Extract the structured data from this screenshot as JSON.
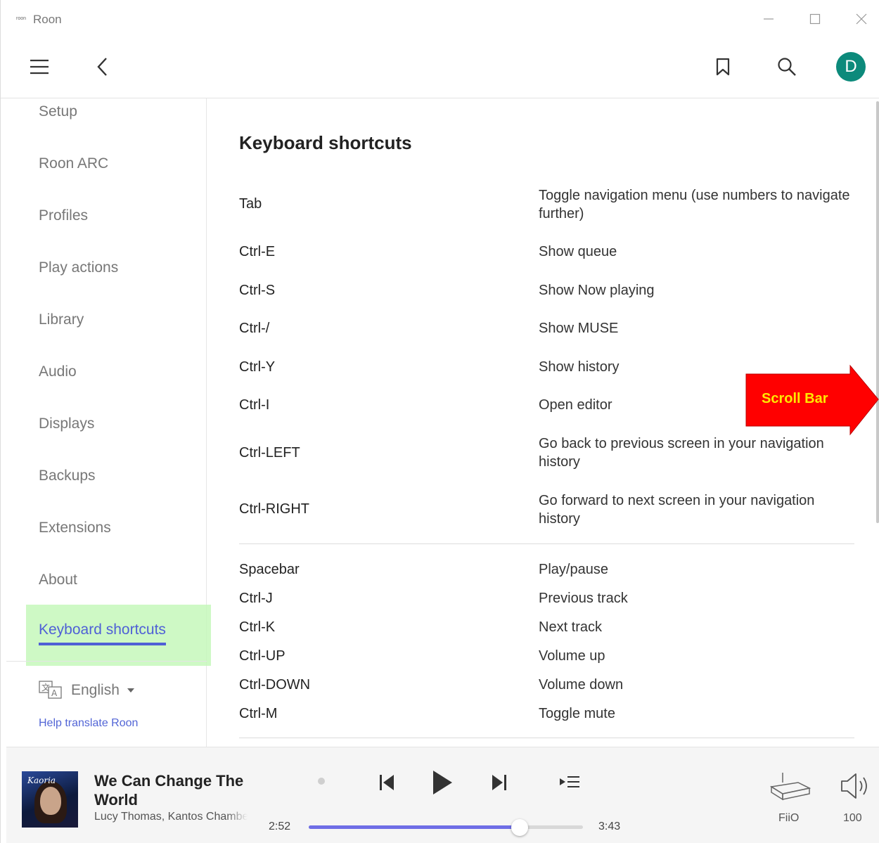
{
  "app": {
    "title": "Roon",
    "icon_text": "roon"
  },
  "toolbar": {
    "icons": [
      "hamburger-menu-icon",
      "back-chevron-icon",
      "bookmark-icon",
      "search-icon"
    ],
    "avatar_letter": "D",
    "avatar_color": "#0c8a7b"
  },
  "sidebar": {
    "items": [
      {
        "label": "Setup"
      },
      {
        "label": "Roon ARC"
      },
      {
        "label": "Profiles"
      },
      {
        "label": "Play actions"
      },
      {
        "label": "Library"
      },
      {
        "label": "Audio"
      },
      {
        "label": "Displays"
      },
      {
        "label": "Backups"
      },
      {
        "label": "Extensions"
      },
      {
        "label": "About"
      }
    ],
    "active_item": "Keyboard shortcuts",
    "active_color": "#4f60d6",
    "language": "English",
    "help_link": "Help translate Roon"
  },
  "main": {
    "title": "Keyboard shortcuts",
    "navigation_shortcuts": [
      {
        "key": "Tab",
        "description": "Toggle navigation menu (use numbers to navigate further)"
      },
      {
        "key": "Ctrl-E",
        "description": "Show queue"
      },
      {
        "key": "Ctrl-S",
        "description": "Show Now playing"
      },
      {
        "key": "Ctrl-/",
        "description": "Show MUSE"
      },
      {
        "key": "Ctrl-Y",
        "description": "Show history"
      },
      {
        "key": "Ctrl-I",
        "description": "Open editor"
      },
      {
        "key": "Ctrl-LEFT",
        "description": "Go back to previous screen in your navigation history"
      },
      {
        "key": "Ctrl-RIGHT",
        "description": "Go forward to next screen in your navigation history"
      }
    ],
    "playback_shortcuts": [
      {
        "key": "Spacebar",
        "description": "Play/pause"
      },
      {
        "key": "Ctrl-J",
        "description": "Previous track"
      },
      {
        "key": "Ctrl-K",
        "description": "Next track"
      },
      {
        "key": "Ctrl-UP",
        "description": "Volume up"
      },
      {
        "key": "Ctrl-DOWN",
        "description": "Volume down"
      },
      {
        "key": "Ctrl-M",
        "description": "Toggle mute"
      }
    ]
  },
  "annotation": {
    "label": "Scroll Bar",
    "arrow_color": "#ff0000",
    "text_color": "#ffe800"
  },
  "player": {
    "album_art_text": "Kaoria",
    "track_title": "We Can Change The World",
    "track_artist": "Lucy Thomas, Kantos Chamber",
    "time_current": "2:52",
    "time_total": "3:43",
    "progress": 0.77,
    "seek_color": "#6f6ee6",
    "zone": "FiiO",
    "volume": "100"
  }
}
